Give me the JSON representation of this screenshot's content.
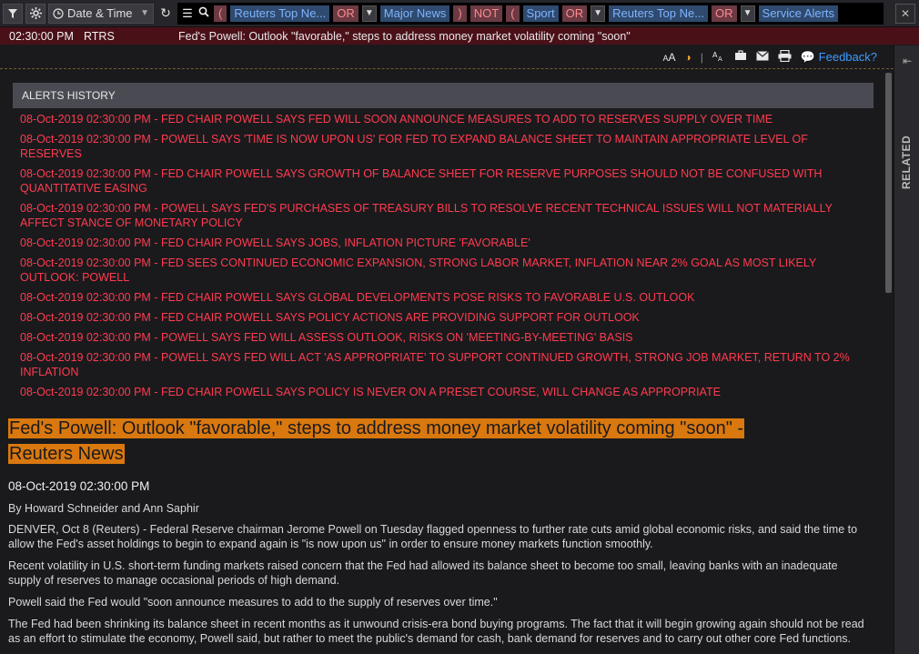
{
  "toolbar": {
    "date_label": "Date & Time",
    "query": [
      {
        "kind": "paren",
        "text": "("
      },
      {
        "kind": "term",
        "text": "Reuters Top Ne..."
      },
      {
        "kind": "op",
        "text": "OR"
      },
      {
        "kind": "dd",
        "text": "v"
      },
      {
        "kind": "term",
        "text": "Major News"
      },
      {
        "kind": "paren",
        "text": ")"
      },
      {
        "kind": "op",
        "text": "NOT"
      },
      {
        "kind": "paren",
        "text": "("
      },
      {
        "kind": "term",
        "text": "Sport"
      },
      {
        "kind": "op",
        "text": "OR"
      },
      {
        "kind": "dd",
        "text": "v"
      },
      {
        "kind": "term",
        "text": "Reuters Top Ne..."
      },
      {
        "kind": "op",
        "text": "OR"
      },
      {
        "kind": "dd",
        "text": "v"
      },
      {
        "kind": "term",
        "text": "Service Alerts"
      }
    ]
  },
  "strip": {
    "time": "02:30:00 PM",
    "source": "RTRS",
    "headline": "Fed's Powell: Outlook \"favorable,\" steps to address money market volatility coming \"soon\""
  },
  "actions": {
    "font_size": "AA",
    "feedback": "Feedback?"
  },
  "side": {
    "related": "RELATED"
  },
  "alerts": {
    "title": "ALERTS HISTORY",
    "items": [
      "08-Oct-2019 02:30:00 PM - FED CHAIR POWELL SAYS FED WILL SOON ANNOUNCE MEASURES TO ADD TO RESERVES SUPPLY OVER TIME",
      "08-Oct-2019 02:30:00 PM - POWELL SAYS 'TIME IS NOW UPON US' FOR FED TO EXPAND BALANCE SHEET TO MAINTAIN APPROPRIATE LEVEL OF RESERVES",
      "08-Oct-2019 02:30:00 PM - FED CHAIR POWELL SAYS GROWTH OF BALANCE SHEET FOR RESERVE PURPOSES SHOULD NOT BE CONFUSED WITH QUANTITATIVE EASING",
      "08-Oct-2019 02:30:00 PM - POWELL SAYS FED'S PURCHASES OF TREASURY BILLS TO RESOLVE RECENT TECHNICAL ISSUES WILL NOT MATERIALLY AFFECT STANCE OF MONETARY POLICY",
      "08-Oct-2019 02:30:00 PM - FED CHAIR POWELL SAYS JOBS, INFLATION PICTURE 'FAVORABLE'",
      "08-Oct-2019 02:30:00 PM - FED SEES CONTINUED ECONOMIC EXPANSION, STRONG LABOR MARKET, INFLATION NEAR 2% GOAL AS MOST LIKELY OUTLOOK: POWELL",
      "08-Oct-2019 02:30:00 PM - FED CHAIR POWELL SAYS GLOBAL DEVELOPMENTS POSE RISKS TO FAVORABLE U.S. OUTLOOK",
      "08-Oct-2019 02:30:00 PM - FED CHAIR POWELL SAYS POLICY ACTIONS ARE PROVIDING SUPPORT FOR OUTLOOK",
      "08-Oct-2019 02:30:00 PM - POWELL SAYS FED WILL ASSESS OUTLOOK, RISKS ON 'MEETING-BY-MEETING' BASIS",
      "08-Oct-2019 02:30:00 PM - POWELL SAYS FED WILL ACT 'AS APPROPRIATE' TO SUPPORT CONTINUED GROWTH, STRONG JOB MARKET, RETURN TO 2% INFLATION",
      "08-Oct-2019 02:30:00 PM - FED CHAIR POWELL SAYS POLICY IS NEVER ON A PRESET COURSE, WILL CHANGE AS APPROPRIATE"
    ]
  },
  "article": {
    "headline": "Fed's Powell: Outlook \"favorable,\" steps to address money market volatility coming \"soon\" - Reuters News",
    "date": "08-Oct-2019 02:30:00 PM",
    "byline": "By Howard Schneider and Ann Saphir",
    "paragraphs": [
      "DENVER, Oct 8 (Reuters) - Federal Reserve chairman Jerome Powell on Tuesday flagged openness to further rate cuts amid global economic risks, and said the time to allow the Fed's asset holdings to begin to expand again is \"is now upon us\" in order to ensure money markets function smoothly.",
      "Recent volatility in U.S. short-term funding markets raised concern that the Fed had allowed its balance sheet to become too small, leaving banks with an inadequate supply of reserves to manage occasional periods of high demand.",
      "Powell said the Fed would \"soon announce measures to add to the supply of reserves over time.\"",
      "The Fed had been shrinking its balance sheet in recent months as it unwound crisis-era bond buying programs. The fact that it will begin growing again should not be read as an effort to stimulate the economy, Powell said, but rather to meet the public's demand for cash, bank demand for reserves and to carry out other core Fed functions."
    ]
  },
  "colors": {
    "alert_text": "#ff3b4e",
    "headline_highlight": "#d9780f",
    "strip_bg": "#4a1018",
    "feedback_link": "#3c9cff"
  }
}
